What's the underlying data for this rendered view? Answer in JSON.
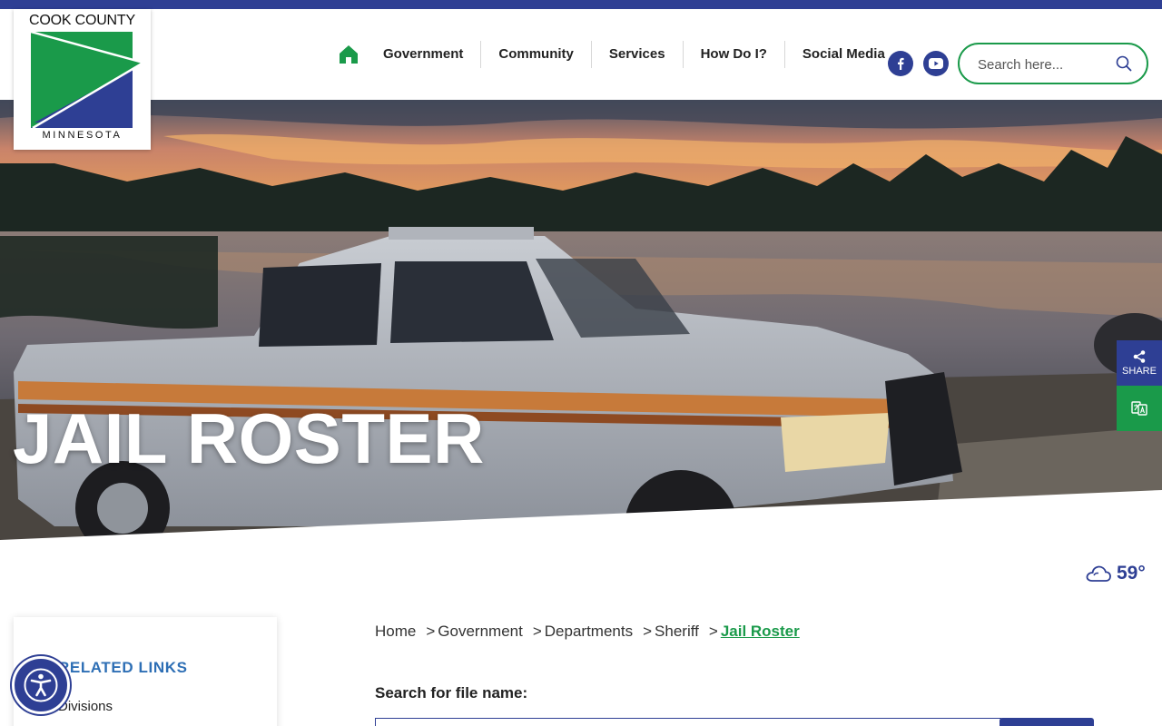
{
  "site": {
    "logo_top": "COOK COUNTY",
    "logo_bottom": "MINNESOTA",
    "logo_colors": {
      "green": "#1a9a4a",
      "blue": "#2e3f94"
    }
  },
  "nav": {
    "home_icon": "home-icon",
    "items": [
      {
        "label": "Government"
      },
      {
        "label": "Community"
      },
      {
        "label": "Services"
      },
      {
        "label": "How Do I?"
      },
      {
        "label": "Social Media"
      }
    ]
  },
  "social": {
    "facebook_icon": "facebook-icon",
    "youtube_icon": "youtube-icon"
  },
  "search": {
    "placeholder": "Search here...",
    "icon": "search-icon"
  },
  "hero": {
    "title": "JAIL ROSTER"
  },
  "side_tools": {
    "share_label": "SHARE",
    "share_icon": "share-icon",
    "translate_icon": "translate-icon"
  },
  "weather": {
    "icon": "cloud-icon",
    "temp": "59°"
  },
  "sidebar": {
    "heading": "RELATED LINKS",
    "items": [
      {
        "label": "Divisions"
      }
    ]
  },
  "breadcrumb": {
    "items": [
      "Home",
      "Government",
      "Departments",
      "Sheriff"
    ],
    "separator": ">",
    "current": "Jail Roster"
  },
  "file_search": {
    "label": "Search for file name:"
  },
  "colors": {
    "brand_blue": "#2e3f94",
    "brand_green": "#1a9a4a",
    "link_blue": "#2e6fb5"
  }
}
